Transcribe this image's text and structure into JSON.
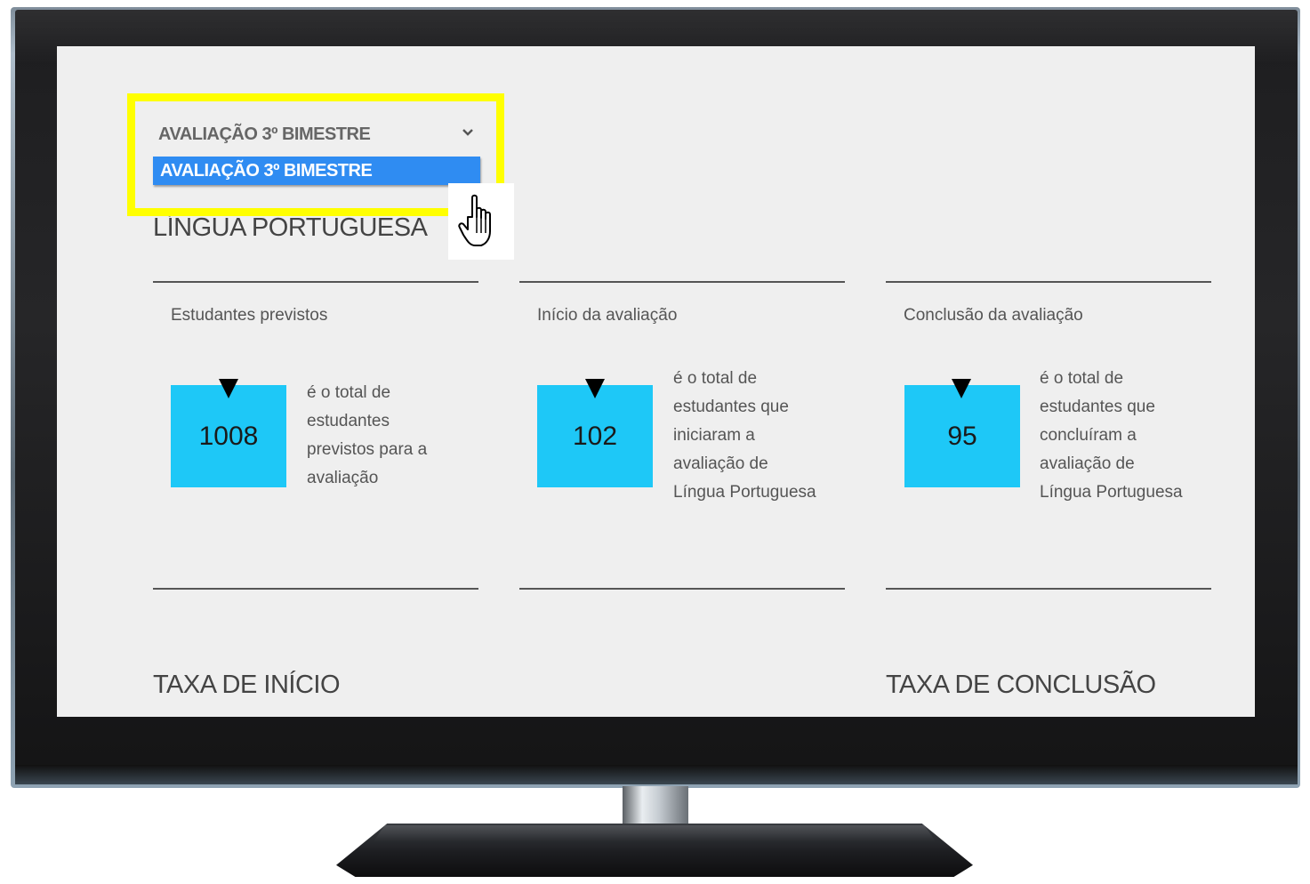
{
  "dropdown": {
    "selected": "AVALIAÇÃO 3º BIMESTRE",
    "options": [
      "AVALIAÇÃO 3º BIMESTRE"
    ]
  },
  "section_title": "LÍNGUA PORTUGUESA",
  "cards": [
    {
      "title": "Estudantes previstos",
      "value": "1008",
      "description_lines": [
        "é o total de",
        "estudantes",
        "previstos para a",
        "avaliação"
      ]
    },
    {
      "title": "Início da avaliação",
      "value": "102",
      "description_lines": [
        "é o total de",
        "estudantes que",
        "iniciaram a",
        "avaliação de",
        "Língua Portuguesa"
      ]
    },
    {
      "title": "Conclusão da avaliação",
      "value": "95",
      "description_lines": [
        "é o total de",
        "estudantes que",
        "concluíram a",
        "avaliação de",
        "Língua Portuguesa"
      ]
    }
  ],
  "rates": {
    "start_title": "TAXA DE INÍCIO",
    "completion_title": "TAXA DE CONCLUSÃO"
  },
  "colors": {
    "highlight": "#ffff00",
    "stat_box": "#1ec8f7",
    "option_selected": "#2f8cf2"
  },
  "icons": [
    "chevron-down-icon",
    "hand-cursor-icon",
    "down-arrow-icon"
  ]
}
